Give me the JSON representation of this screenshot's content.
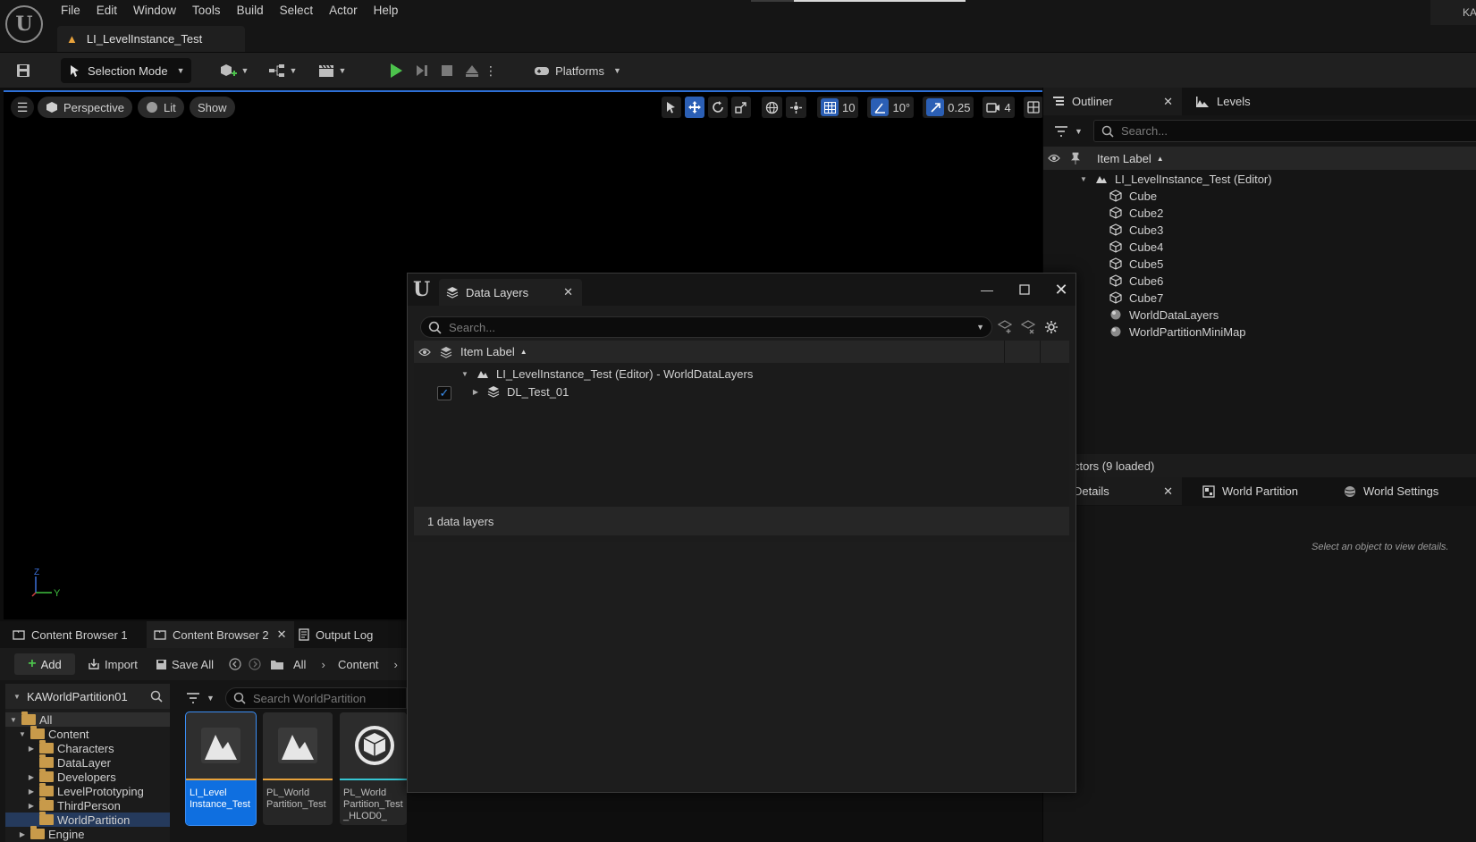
{
  "menu": [
    "File",
    "Edit",
    "Window",
    "Tools",
    "Build",
    "Select",
    "Actor",
    "Help"
  ],
  "level_tab": "LI_LevelInstance_Test",
  "user_badge": "KA",
  "toolbar": {
    "selection_mode": "Selection Mode",
    "platforms": "Platforms"
  },
  "viewport": {
    "perspective": "Perspective",
    "lit": "Lit",
    "show": "Show",
    "grid_snap": "10",
    "rotation_snap": "10°",
    "scale_snap": "0.25",
    "camera_speed": "4",
    "axis_y": "Y",
    "axis_z": "Z"
  },
  "outliner": {
    "tab": "Outliner",
    "levels_tab": "Levels",
    "search_placeholder": "Search...",
    "column": "Item Label",
    "root": "LI_LevelInstance_Test (Editor)",
    "items": [
      "Cube",
      "Cube2",
      "Cube3",
      "Cube4",
      "Cube5",
      "Cube6",
      "Cube7",
      "WorldDataLayers",
      "WorldPartitionMiniMap"
    ],
    "actors_count": "ctors (9 loaded)"
  },
  "details": {
    "tab": "Details",
    "world_partition_tab": "World Partition",
    "world_settings_tab": "World Settings",
    "empty_message": "Select an object to view details."
  },
  "data_layers": {
    "title": "Data Layers",
    "search_placeholder": "Search...",
    "column": "Item Label",
    "root": "LI_LevelInstance_Test (Editor) - WorldDataLayers",
    "layer": "DL_Test_01",
    "status": "1 data layers"
  },
  "content_browser": {
    "tab1": "Content Browser 1",
    "tab2": "Content Browser 2",
    "tab3": "Output Log",
    "add": "Add",
    "import": "Import",
    "save_all": "Save All",
    "path_all": "All",
    "path_content": "Content",
    "project": "KAWorldPartition01",
    "search_placeholder": "Search WorldPartition",
    "tree": {
      "all": "All",
      "content": "Content",
      "characters": "Characters",
      "datalayer": "DataLayer",
      "developers": "Developers",
      "levelprototyping": "LevelPrototyping",
      "thirdperson": "ThirdPerson",
      "worldpartition": "WorldPartition",
      "engine": "Engine"
    },
    "assets": [
      {
        "line1": "LI_Level",
        "line2": "Instance_Test",
        "line3": ""
      },
      {
        "line1": "PL_World",
        "line2": "Partition_Test",
        "line3": ""
      },
      {
        "line1": "PL_World",
        "line2": "Partition_Test",
        "line3": "_HLOD0_"
      }
    ]
  },
  "colors": {
    "accent_blue": "#2b5fb5",
    "selection_blue": "#0f6fe0",
    "play_green": "#4cc24c",
    "level_orange": "#e8a23b"
  }
}
